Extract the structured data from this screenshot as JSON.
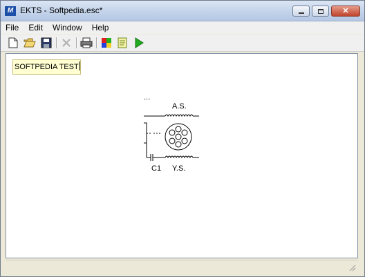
{
  "window": {
    "title": "EKTS - Softpedia.esc*",
    "app_icon_letter": "M"
  },
  "window_controls": {
    "close_glyph": "✕"
  },
  "menu": {
    "items": [
      "File",
      "Edit",
      "Window",
      "Help"
    ]
  },
  "toolbar": {
    "buttons": [
      {
        "name": "new-file",
        "icon": "page-icon"
      },
      {
        "name": "open-file",
        "icon": "folder-open-icon"
      },
      {
        "name": "save-file",
        "icon": "floppy-disk-icon"
      },
      {
        "name": "delete",
        "icon": "x-icon",
        "enabled": false
      },
      {
        "name": "print",
        "icon": "printer-icon"
      },
      {
        "name": "colors",
        "icon": "color-squares-icon"
      },
      {
        "name": "notes",
        "icon": "notepad-icon"
      },
      {
        "name": "run",
        "icon": "play-icon"
      }
    ]
  },
  "canvas": {
    "note_text": "SOFTPEDIA TEST",
    "diagram": {
      "ellipsis": "...",
      "label_top": "A.S.",
      "label_capacitor": "C1",
      "label_bottom": "Y.S."
    }
  },
  "colors": {
    "note_bg": "#ffffd2",
    "run_green": "#22aa22"
  }
}
